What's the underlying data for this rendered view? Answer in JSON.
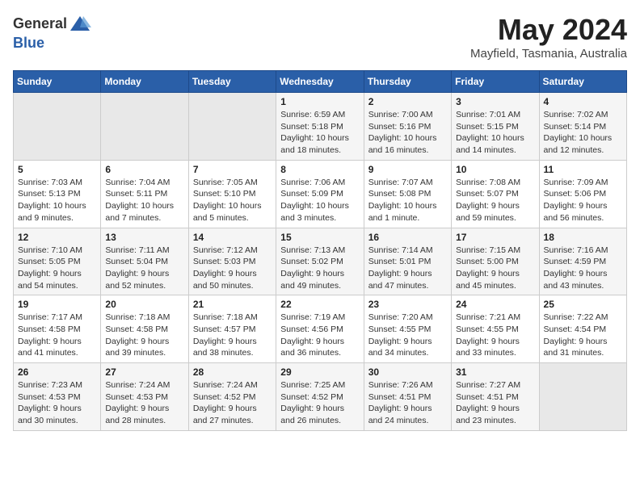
{
  "header": {
    "logo_general": "General",
    "logo_blue": "Blue",
    "month": "May 2024",
    "location": "Mayfield, Tasmania, Australia"
  },
  "weekdays": [
    "Sunday",
    "Monday",
    "Tuesday",
    "Wednesday",
    "Thursday",
    "Friday",
    "Saturday"
  ],
  "weeks": [
    [
      {
        "day": "",
        "info": ""
      },
      {
        "day": "",
        "info": ""
      },
      {
        "day": "",
        "info": ""
      },
      {
        "day": "1",
        "info": "Sunrise: 6:59 AM\nSunset: 5:18 PM\nDaylight: 10 hours\nand 18 minutes."
      },
      {
        "day": "2",
        "info": "Sunrise: 7:00 AM\nSunset: 5:16 PM\nDaylight: 10 hours\nand 16 minutes."
      },
      {
        "day": "3",
        "info": "Sunrise: 7:01 AM\nSunset: 5:15 PM\nDaylight: 10 hours\nand 14 minutes."
      },
      {
        "day": "4",
        "info": "Sunrise: 7:02 AM\nSunset: 5:14 PM\nDaylight: 10 hours\nand 12 minutes."
      }
    ],
    [
      {
        "day": "5",
        "info": "Sunrise: 7:03 AM\nSunset: 5:13 PM\nDaylight: 10 hours\nand 9 minutes."
      },
      {
        "day": "6",
        "info": "Sunrise: 7:04 AM\nSunset: 5:11 PM\nDaylight: 10 hours\nand 7 minutes."
      },
      {
        "day": "7",
        "info": "Sunrise: 7:05 AM\nSunset: 5:10 PM\nDaylight: 10 hours\nand 5 minutes."
      },
      {
        "day": "8",
        "info": "Sunrise: 7:06 AM\nSunset: 5:09 PM\nDaylight: 10 hours\nand 3 minutes."
      },
      {
        "day": "9",
        "info": "Sunrise: 7:07 AM\nSunset: 5:08 PM\nDaylight: 10 hours\nand 1 minute."
      },
      {
        "day": "10",
        "info": "Sunrise: 7:08 AM\nSunset: 5:07 PM\nDaylight: 9 hours\nand 59 minutes."
      },
      {
        "day": "11",
        "info": "Sunrise: 7:09 AM\nSunset: 5:06 PM\nDaylight: 9 hours\nand 56 minutes."
      }
    ],
    [
      {
        "day": "12",
        "info": "Sunrise: 7:10 AM\nSunset: 5:05 PM\nDaylight: 9 hours\nand 54 minutes."
      },
      {
        "day": "13",
        "info": "Sunrise: 7:11 AM\nSunset: 5:04 PM\nDaylight: 9 hours\nand 52 minutes."
      },
      {
        "day": "14",
        "info": "Sunrise: 7:12 AM\nSunset: 5:03 PM\nDaylight: 9 hours\nand 50 minutes."
      },
      {
        "day": "15",
        "info": "Sunrise: 7:13 AM\nSunset: 5:02 PM\nDaylight: 9 hours\nand 49 minutes."
      },
      {
        "day": "16",
        "info": "Sunrise: 7:14 AM\nSunset: 5:01 PM\nDaylight: 9 hours\nand 47 minutes."
      },
      {
        "day": "17",
        "info": "Sunrise: 7:15 AM\nSunset: 5:00 PM\nDaylight: 9 hours\nand 45 minutes."
      },
      {
        "day": "18",
        "info": "Sunrise: 7:16 AM\nSunset: 4:59 PM\nDaylight: 9 hours\nand 43 minutes."
      }
    ],
    [
      {
        "day": "19",
        "info": "Sunrise: 7:17 AM\nSunset: 4:58 PM\nDaylight: 9 hours\nand 41 minutes."
      },
      {
        "day": "20",
        "info": "Sunrise: 7:18 AM\nSunset: 4:58 PM\nDaylight: 9 hours\nand 39 minutes."
      },
      {
        "day": "21",
        "info": "Sunrise: 7:18 AM\nSunset: 4:57 PM\nDaylight: 9 hours\nand 38 minutes."
      },
      {
        "day": "22",
        "info": "Sunrise: 7:19 AM\nSunset: 4:56 PM\nDaylight: 9 hours\nand 36 minutes."
      },
      {
        "day": "23",
        "info": "Sunrise: 7:20 AM\nSunset: 4:55 PM\nDaylight: 9 hours\nand 34 minutes."
      },
      {
        "day": "24",
        "info": "Sunrise: 7:21 AM\nSunset: 4:55 PM\nDaylight: 9 hours\nand 33 minutes."
      },
      {
        "day": "25",
        "info": "Sunrise: 7:22 AM\nSunset: 4:54 PM\nDaylight: 9 hours\nand 31 minutes."
      }
    ],
    [
      {
        "day": "26",
        "info": "Sunrise: 7:23 AM\nSunset: 4:53 PM\nDaylight: 9 hours\nand 30 minutes."
      },
      {
        "day": "27",
        "info": "Sunrise: 7:24 AM\nSunset: 4:53 PM\nDaylight: 9 hours\nand 28 minutes."
      },
      {
        "day": "28",
        "info": "Sunrise: 7:24 AM\nSunset: 4:52 PM\nDaylight: 9 hours\nand 27 minutes."
      },
      {
        "day": "29",
        "info": "Sunrise: 7:25 AM\nSunset: 4:52 PM\nDaylight: 9 hours\nand 26 minutes."
      },
      {
        "day": "30",
        "info": "Sunrise: 7:26 AM\nSunset: 4:51 PM\nDaylight: 9 hours\nand 24 minutes."
      },
      {
        "day": "31",
        "info": "Sunrise: 7:27 AM\nSunset: 4:51 PM\nDaylight: 9 hours\nand 23 minutes."
      },
      {
        "day": "",
        "info": ""
      }
    ]
  ]
}
